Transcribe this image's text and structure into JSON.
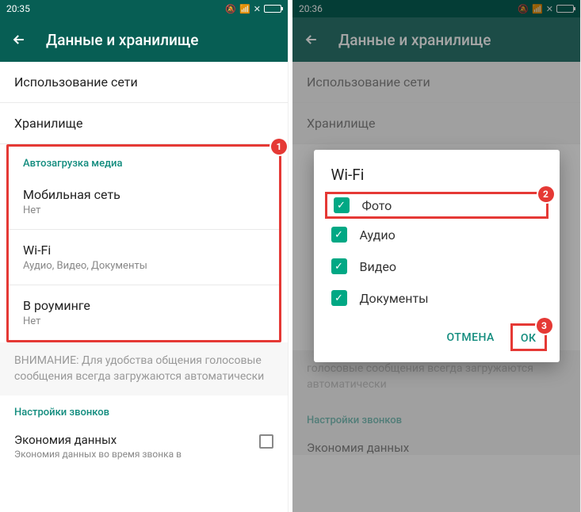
{
  "left": {
    "status_time": "20:35",
    "title": "Данные и хранилище",
    "items": {
      "net_usage": "Использование сети",
      "storage": "Хранилище"
    },
    "section_media": "Автозагрузка медиа",
    "badge1": "1",
    "media": [
      {
        "title": "Мобильная сеть",
        "sub": "Нет"
      },
      {
        "title": "Wi-Fi",
        "sub": "Аудио, Видео, Документы"
      },
      {
        "title": "В роуминге",
        "sub": "Нет"
      }
    ],
    "notice": "ВНИМАНИЕ: Для удобства общения голосовые сообщения всегда загружаются автоматически",
    "section_calls": "Настройки звонков",
    "savings_title": "Экономия данных",
    "savings_sub": "Экономия данных во время звонка в"
  },
  "right": {
    "status_time": "20:36",
    "title": "Данные и хранилище",
    "items": {
      "net_usage": "Использование сети",
      "storage": "Хранилище"
    },
    "notice": "голосовые сообщения всегда загружаются автоматически",
    "section_calls": "Настройки звонков",
    "savings_title": "Экономия данных",
    "dialog": {
      "title": "Wi-Fi",
      "badge2": "2",
      "badge3": "3",
      "options": {
        "photo": "Фото",
        "audio": "Аудио",
        "video": "Видео",
        "docs": "Документы"
      },
      "cancel": "ОТМЕНА",
      "ok": "ОК"
    }
  }
}
